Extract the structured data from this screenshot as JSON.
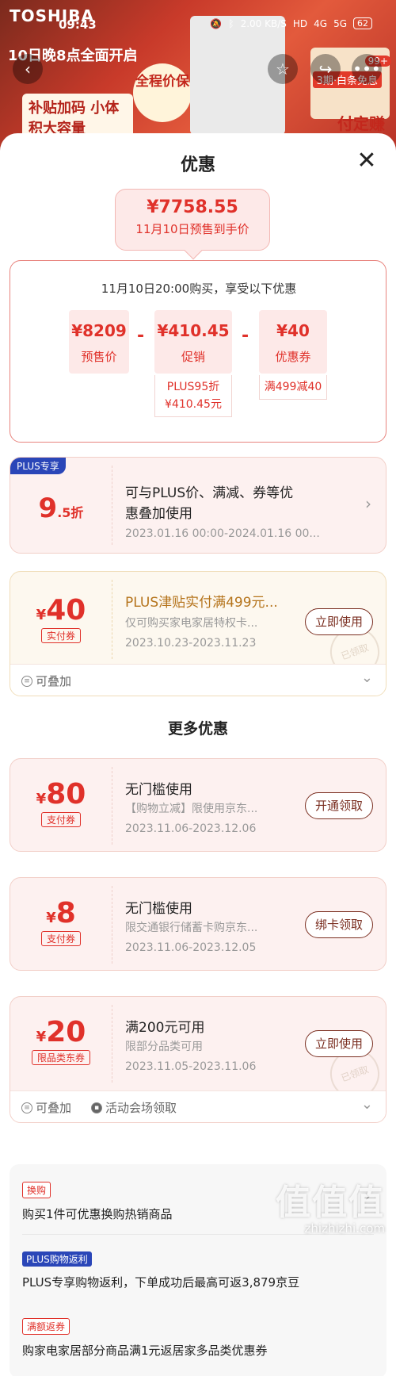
{
  "status_bar": {
    "time": "09:43",
    "net_speed": "2.00 KB/S",
    "hd": "HD",
    "signal1": "4G",
    "signal2": "5G",
    "battery": "62"
  },
  "background": {
    "brand": "TOSHIBA",
    "promo_line1": "10日晚8点全面开启",
    "promo_line2": "补贴加码 小体积大容量",
    "badge": "全程价保",
    "right_tag": "3期·白条免息",
    "right_big": "付定赚",
    "right_count": "99+"
  },
  "sheet": {
    "title": "优惠",
    "price_bubble": {
      "price": "¥7758.55",
      "subtitle": "11月10日预售到手价"
    },
    "breakdown": {
      "heading": "11月10日20:00购买，享受以下优惠",
      "items": [
        {
          "value": "¥8209",
          "label": "预售价"
        },
        {
          "value": "¥410.45",
          "label": "促销"
        },
        {
          "value": "¥40",
          "label": "优惠券"
        }
      ],
      "minus": "-",
      "promo_detail_line1": "PLUS95折",
      "promo_detail_line2": "¥410.45元",
      "coupon_detail": "满499减40"
    },
    "plus_coupon": {
      "badge": "PLUS专享",
      "discount_big": "9",
      "discount_small": ".5折",
      "title_line1": "可与PLUS价、满减、券等优",
      "title_line2": "惠叠加使用",
      "date": "2023.01.16 00:00-2024.01.16 00..."
    },
    "jintie_coupon": {
      "yen": "¥",
      "amount": "40",
      "tag": "实付券",
      "title": "PLUS津贴实付满499元...",
      "desc": "仅可购买家电家居特权卡...",
      "date": "2023.10.23-2023.11.23",
      "button": "立即使用",
      "stamp": "已领取",
      "footer": "可叠加"
    },
    "more_title": "更多优惠",
    "coupons": [
      {
        "yen": "¥",
        "amount": "80",
        "tag": "支付券",
        "title": "无门槛使用",
        "desc": "【购物立减】限使用京东...",
        "date": "2023.11.06-2023.12.06",
        "button": "开通领取"
      },
      {
        "yen": "¥",
        "amount": "8",
        "tag": "支付券",
        "title": "无门槛使用",
        "desc": "限交通银行储蓄卡购京东...",
        "date": "2023.11.06-2023.12.05",
        "button": "绑卡领取"
      },
      {
        "yen": "¥",
        "amount": "20",
        "tag": "限品类东券",
        "title": "满200元可用",
        "desc": "限部分品类可用",
        "date": "2023.11.05-2023.11.06",
        "button": "立即使用",
        "stamp": "已领取"
      }
    ],
    "last_footer": {
      "stack": "可叠加",
      "venue": "活动会场领取"
    },
    "info": [
      {
        "tag": "换购",
        "text": "购买1件可优惠换购热销商品"
      },
      {
        "tag": "PLUS购物返利",
        "text": "PLUS专享购物返利，下单成功后最高可返3,879京豆"
      },
      {
        "tag": "满额返券",
        "text": "购家电家居部分商品满1元返居家多品类优惠券"
      }
    ]
  },
  "watermark": {
    "text": "值值值",
    "url": "zhizhizhi.com"
  }
}
